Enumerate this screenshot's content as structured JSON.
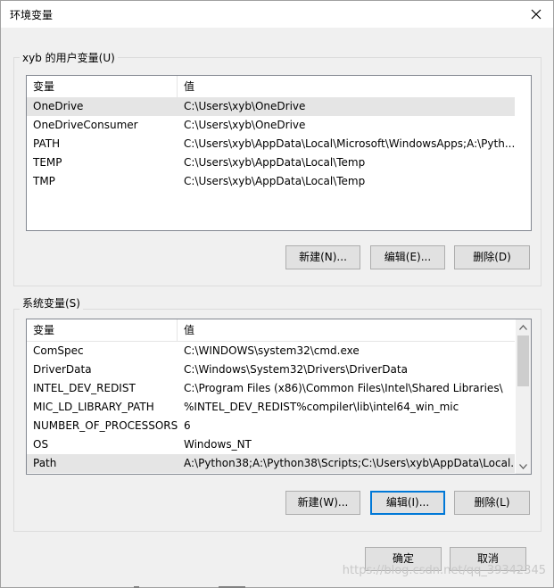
{
  "window": {
    "title": "环境变量"
  },
  "user_vars": {
    "label": "xyb 的用户变量(U)",
    "columns": {
      "name": "变量",
      "value": "值"
    },
    "rows": [
      {
        "name": "OneDrive",
        "value": "C:\\Users\\xyb\\OneDrive"
      },
      {
        "name": "OneDriveConsumer",
        "value": "C:\\Users\\xyb\\OneDrive"
      },
      {
        "name": "PATH",
        "value": "C:\\Users\\xyb\\AppData\\Local\\Microsoft\\WindowsApps;A:\\Pyth..."
      },
      {
        "name": "TEMP",
        "value": "C:\\Users\\xyb\\AppData\\Local\\Temp"
      },
      {
        "name": "TMP",
        "value": "C:\\Users\\xyb\\AppData\\Local\\Temp"
      }
    ],
    "buttons": {
      "new": "新建(N)...",
      "edit": "编辑(E)...",
      "delete": "删除(D)"
    }
  },
  "system_vars": {
    "label": "系统变量(S)",
    "columns": {
      "name": "变量",
      "value": "值"
    },
    "rows": [
      {
        "name": "ComSpec",
        "value": "C:\\WINDOWS\\system32\\cmd.exe"
      },
      {
        "name": "DriverData",
        "value": "C:\\Windows\\System32\\Drivers\\DriverData"
      },
      {
        "name": "INTEL_DEV_REDIST",
        "value": "C:\\Program Files (x86)\\Common Files\\Intel\\Shared Libraries\\"
      },
      {
        "name": "MIC_LD_LIBRARY_PATH",
        "value": "%INTEL_DEV_REDIST%compiler\\lib\\intel64_win_mic"
      },
      {
        "name": "NUMBER_OF_PROCESSORS",
        "value": "6"
      },
      {
        "name": "OS",
        "value": "Windows_NT"
      },
      {
        "name": "Path",
        "value": "A:\\Python38;A:\\Python38\\Scripts;C:\\Users\\xyb\\AppData\\Local..."
      }
    ],
    "buttons": {
      "new": "新建(W)...",
      "edit": "编辑(I)...",
      "delete": "删除(L)"
    }
  },
  "footer": {
    "ok": "确定",
    "cancel": "取消"
  },
  "watermark": "https://blog.csdn.net/qq_39342345",
  "colors": {
    "selected_row": "#e5e5e5",
    "focus_border": "#0078d7",
    "button_bg": "#e1e1e1"
  }
}
